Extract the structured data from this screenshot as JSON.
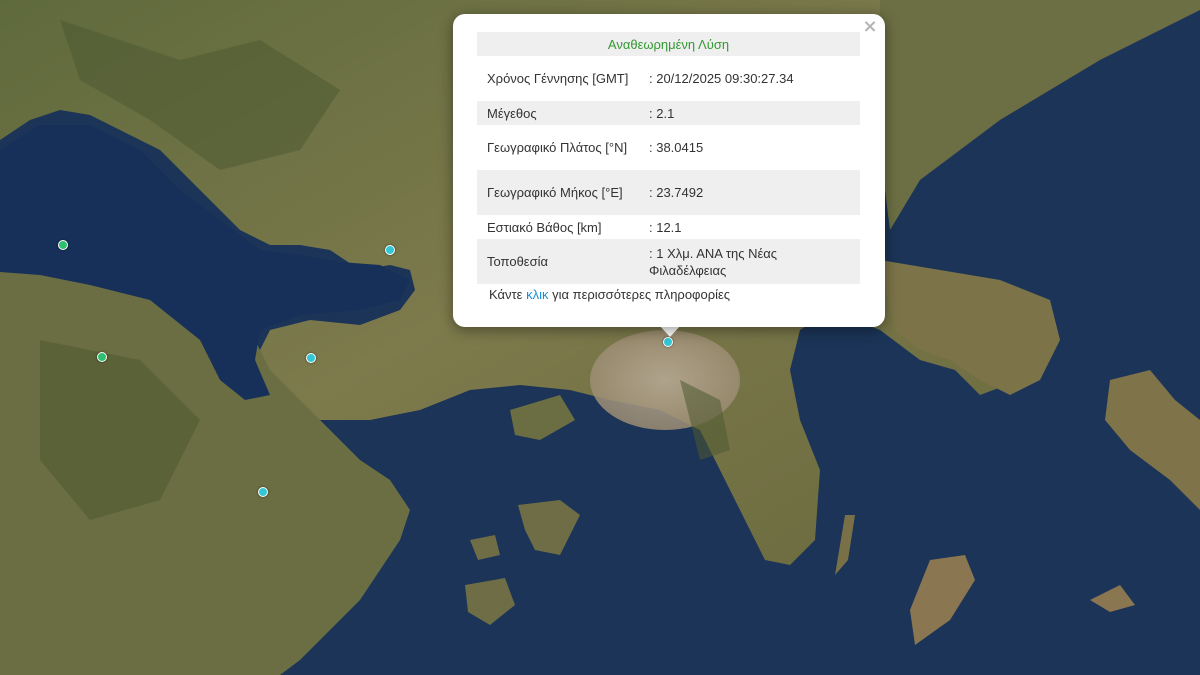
{
  "popup": {
    "title": "Αναθεωρημένη Λύση",
    "rows": [
      {
        "label": "Χρόνος Γέννησης [GMT]",
        "value": ": 20/12/2025 09:30:27.34"
      },
      {
        "label": "Μέγεθος",
        "value": ": 2.1"
      },
      {
        "label": "Γεωγραφικό Πλάτος [°N]",
        "value": ": 38.0415"
      },
      {
        "label": "Γεωγραφικό Μήκος [°E]",
        "value": ": 23.7492"
      },
      {
        "label": "Εστιακό Βάθος [km]",
        "value": ": 12.1"
      },
      {
        "label": "Τοποθεσία",
        "value": ": 1 Χλμ. ΑΝΑ της Νέας Φιλαδέλφειας"
      }
    ],
    "footer_prefix": "Κάντε ",
    "footer_link": "κλικ",
    "footer_suffix": " για περισσότερες πληροφορίες",
    "close_symbol": "×"
  },
  "colors": {
    "sea": "#1b3457",
    "land": "#6e7245",
    "marker_recent": "#33c7d6",
    "marker_older": "#2fbf71",
    "title_green": "#339933",
    "link_blue": "#1a8fd6"
  }
}
